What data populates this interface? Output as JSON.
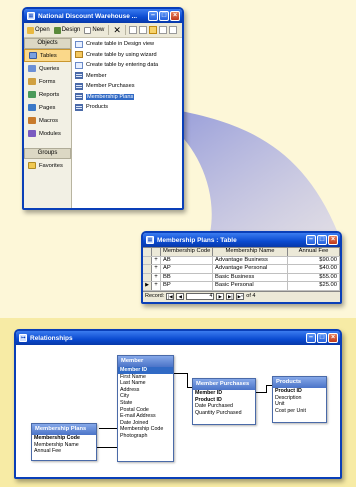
{
  "database_window": {
    "title": "National Discount Warehouse ...",
    "toolbar": {
      "open": "Open",
      "design": "Design",
      "new": "New"
    },
    "objects_header": "Objects",
    "objects": [
      "Tables",
      "Queries",
      "Forms",
      "Reports",
      "Pages",
      "Macros",
      "Modules"
    ],
    "groups_header": "Groups",
    "groups": [
      "Favorites"
    ],
    "list": [
      "Create table in Design view",
      "Create table by using wizard",
      "Create table by entering data",
      "Member",
      "Member Purchases",
      "Membership Plans",
      "Products"
    ]
  },
  "table_window": {
    "title": "Membership Plans : Table",
    "columns": [
      "Membership Code",
      "Membership Name",
      "Annual Fee"
    ],
    "rows": [
      [
        "AB",
        "Advantage Business",
        "$90.00"
      ],
      [
        "AP",
        "Advantage Personal",
        "$40.00"
      ],
      [
        "BB",
        "Basic Business",
        "$55.00"
      ],
      [
        "BP",
        "Basic Personal",
        "$25.00"
      ]
    ],
    "record_label": "Record:",
    "record_current": "4",
    "record_of": "of 4"
  },
  "relationships_window": {
    "title": "Relationships",
    "tables": {
      "member": {
        "title": "Member",
        "fields": [
          "Member ID",
          "First Name",
          "Last Name",
          "Address",
          "City",
          "State",
          "Postal Code",
          "E-mail Address",
          "Date Joined",
          "Membership Code",
          "Photograph"
        ]
      },
      "member_purchases": {
        "title": "Member Purchases",
        "fields": [
          "Member ID",
          "Product ID",
          "Date Purchased",
          "Quantity Purchased"
        ]
      },
      "products": {
        "title": "Products",
        "fields": [
          "Product ID",
          "Description",
          "Unit",
          "Cost per Unit"
        ]
      },
      "membership_plans": {
        "title": "Membership Plans",
        "fields": [
          "Membership Code",
          "Membership Name",
          "Annual Fee"
        ]
      }
    }
  }
}
